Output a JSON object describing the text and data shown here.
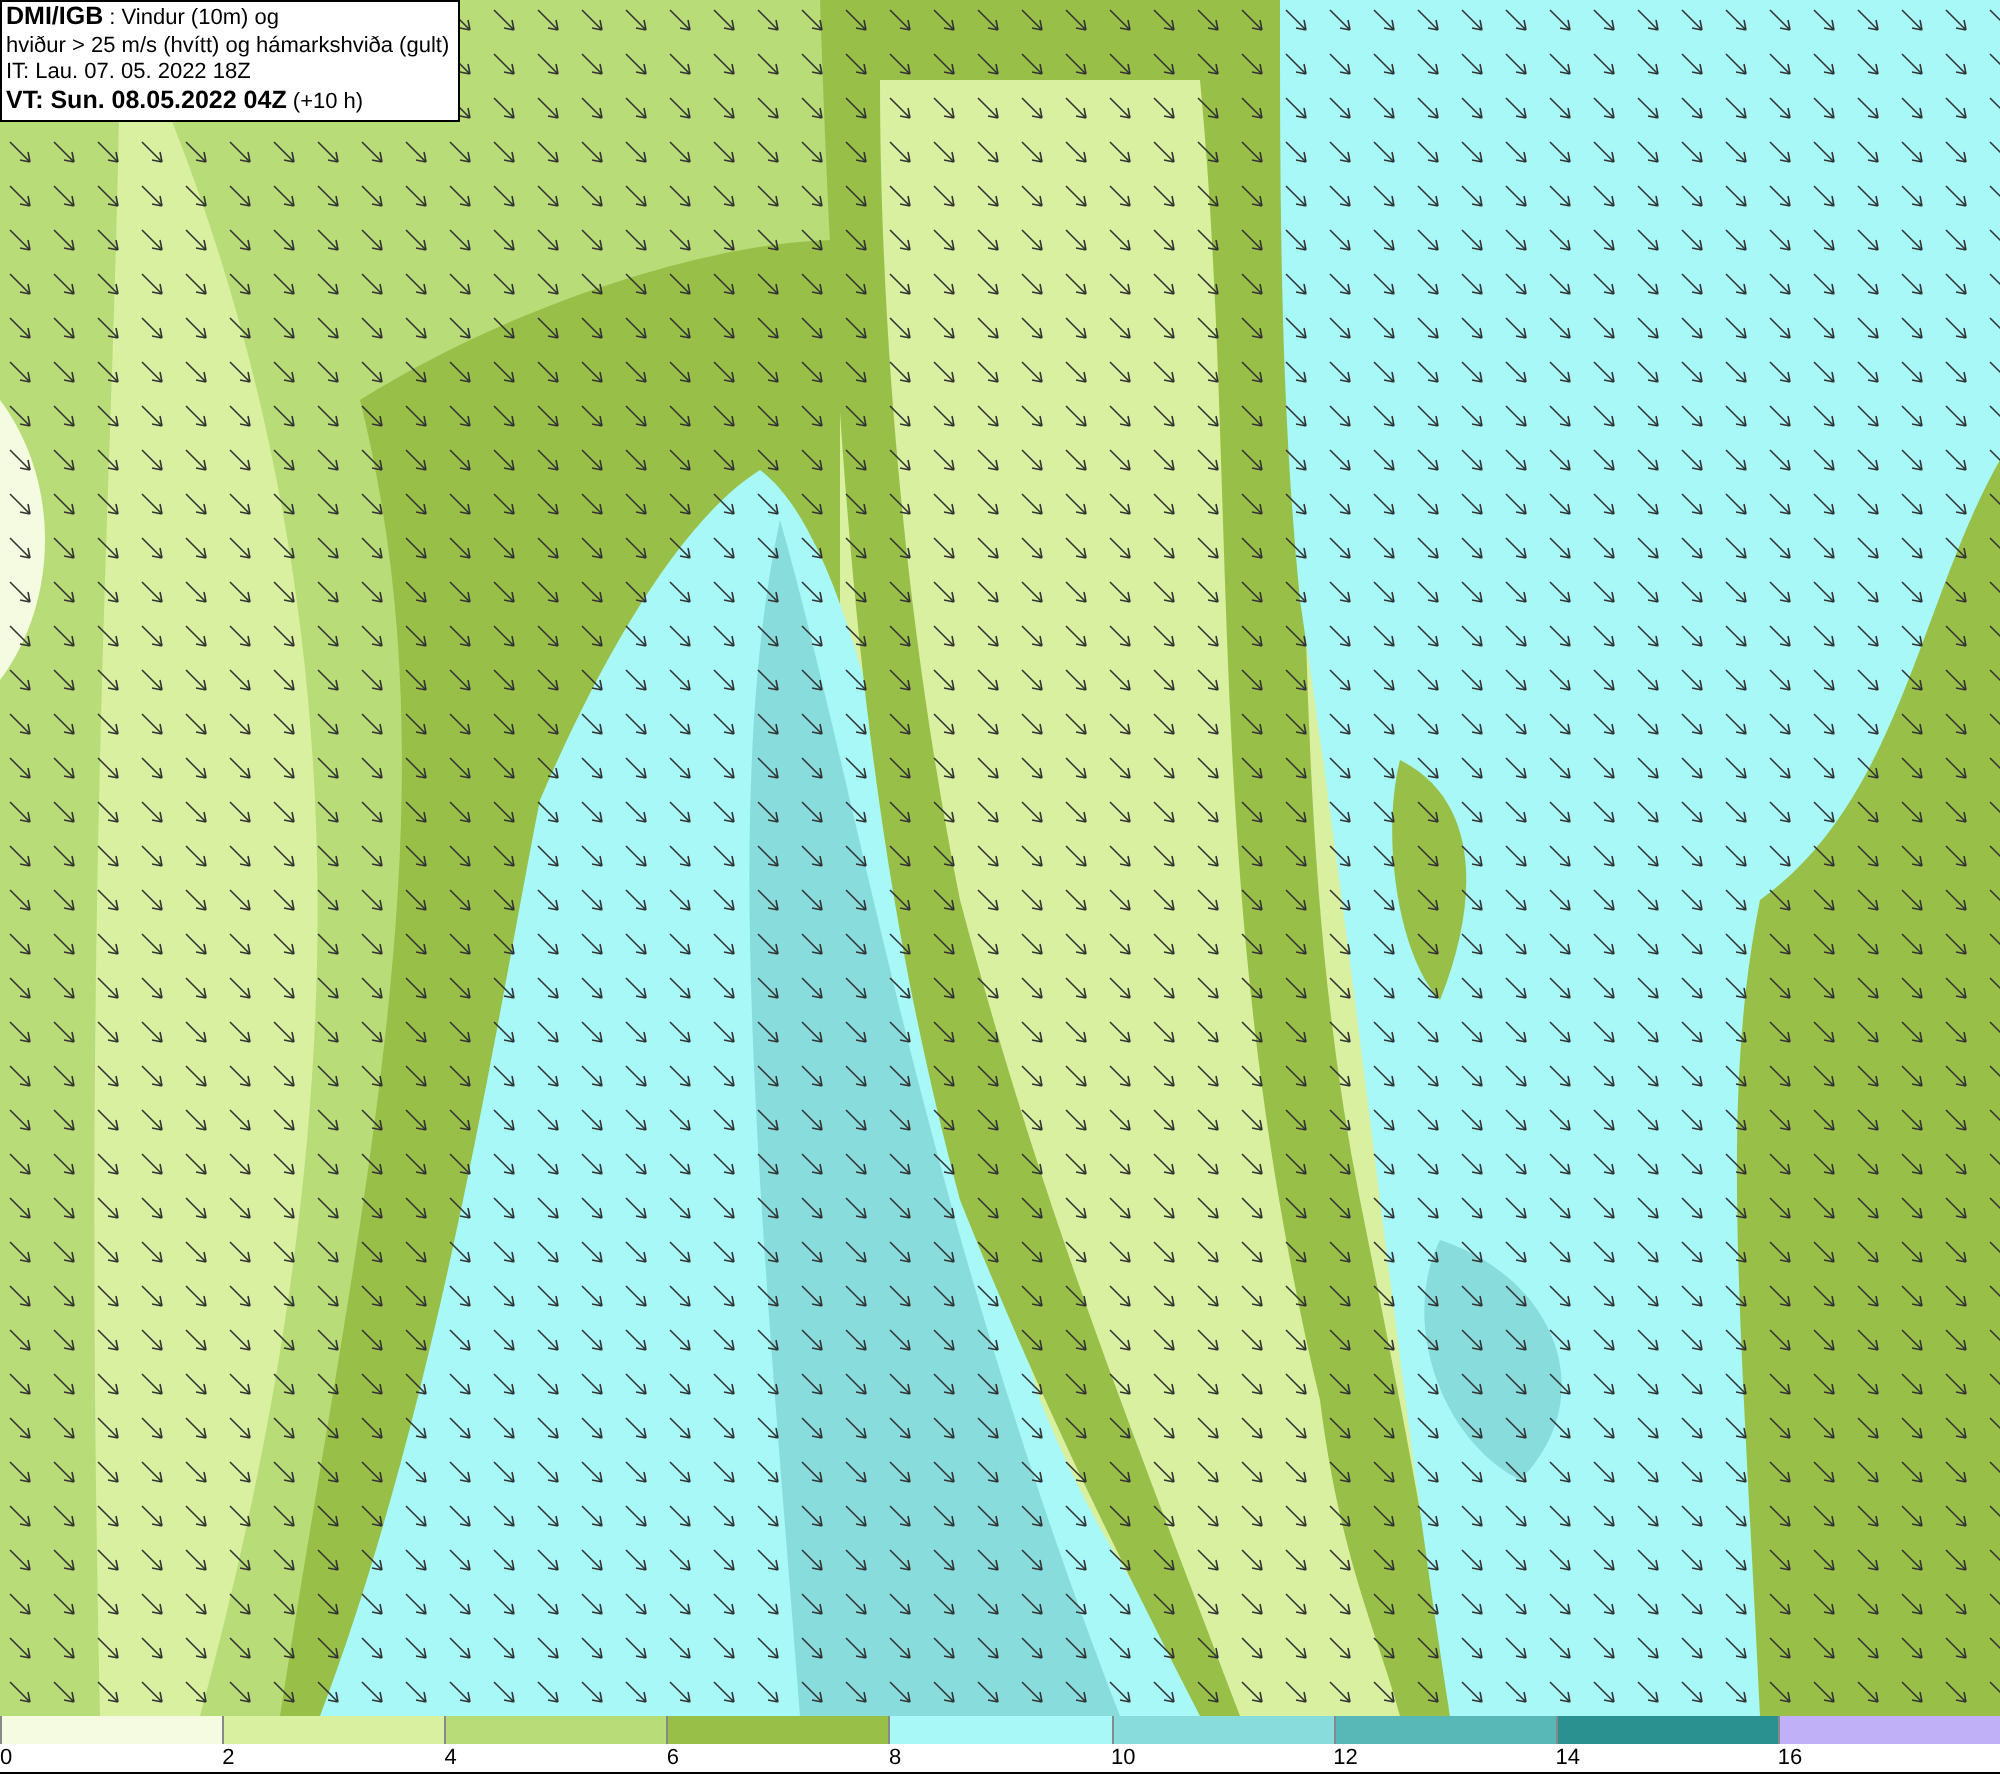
{
  "header": {
    "lines": [
      "**DMI/IGB** : Vindur (10m) og",
      "hviður > 25 m/s (hvítt) og hámarkshviða (gult)",
      "IT: Lau. 07. 05. 2022 18Z",
      "**VT: Sun. 08.05.2022 04Z** (+10 h)"
    ]
  },
  "legend": [
    {
      "label": "0",
      "color": "#f5fbe0"
    },
    {
      "label": "2",
      "color": "#d8f0a0"
    },
    {
      "label": "4",
      "color": "#b8dc78"
    },
    {
      "label": "6",
      "color": "#98c048"
    },
    {
      "label": "8",
      "color": "#a8f8f8"
    },
    {
      "label": "10",
      "color": "#88dcdc"
    },
    {
      "label": "12",
      "color": "#58b8b8"
    },
    {
      "label": "14",
      "color": "#2a9090"
    },
    {
      "label": "16",
      "color": "#c0b0f8"
    }
  ]
}
